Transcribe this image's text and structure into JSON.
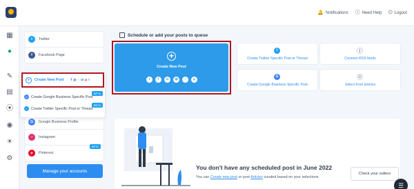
{
  "topbar": {
    "notifications_label": "Notifications",
    "help_label": "Need Help",
    "logout_label": "Logout",
    "notifications_icon": "bell-icon",
    "help_icon": "question-circle-icon",
    "logout_icon": "power-icon"
  },
  "rail_icons": [
    "dashboard-icon",
    "dollar-icon",
    "edit-icon",
    "document-icon",
    "rss-icon",
    "circle-target-icon",
    "bulb-icon",
    "settings-icon"
  ],
  "sidebar": {
    "accounts": [
      {
        "label": "Twitter",
        "icon": "twitter-icon",
        "color": "#1da1f2"
      },
      {
        "label": "Facebook Page",
        "icon": "facebook-icon",
        "color": "#3b5998"
      },
      {
        "label": "Google Business Profile",
        "icon": "google-business-icon",
        "color": "#4285f4"
      },
      {
        "label": "Instagram",
        "icon": "instagram-icon",
        "color": "#e1306c"
      },
      {
        "label": "Pinterest",
        "icon": "pinterest-icon",
        "color": "#e60023",
        "badge": "BETA"
      }
    ],
    "manage_label": "Manage your accounts"
  },
  "popup": {
    "create_new_post_label": "Create New Post",
    "items": [
      {
        "label": "Create Google Business Specific Post",
        "badge": "BETA"
      },
      {
        "label": "Create Twitter Specific Post or Thread",
        "badge": "BETA"
      }
    ]
  },
  "main": {
    "section_title": "Schedule or add your posts to queue",
    "hero_label": "Create New Post",
    "cards": [
      {
        "label": "Create Twitter Specific Post or Thread",
        "icon": "twitter-icon"
      },
      {
        "label": "Connect RSS feeds",
        "icon": "rss-icon"
      },
      {
        "label": "Create Google Business Specific Post",
        "icon": "google-business-icon"
      },
      {
        "label": "Select from articles",
        "icon": "articles-icon"
      }
    ],
    "schedule_title": "You don't have any scheduled post in June 2022",
    "schedule_sub_prefix": "You can",
    "schedule_link1": "Create new post",
    "schedule_sub_mid": "or post",
    "schedule_link2": "Articles",
    "schedule_sub_suffix": "curated based on your selections",
    "outbox_label": "Check your outbox"
  },
  "colors": {
    "accent": "#2d8cf0",
    "hero": "#2d9bea",
    "highlight": "#b0141e"
  }
}
